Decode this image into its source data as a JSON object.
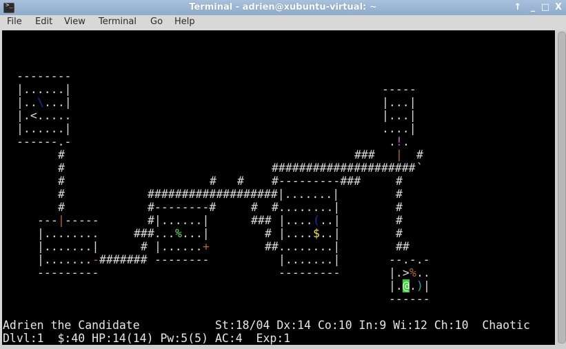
{
  "window": {
    "title": "Terminal - adrien@xubuntu-virtual: ~",
    "icon": "terminal-icon",
    "controls": [
      {
        "name": "keep-above-button",
        "glyph": "↑"
      },
      {
        "name": "minimize-button",
        "glyph": "_"
      },
      {
        "name": "maximize-button",
        "glyph": "□"
      },
      {
        "name": "close-button",
        "glyph": "X"
      }
    ]
  },
  "menu": [
    "File",
    "Edit",
    "View",
    "Terminal",
    "Go",
    "Help"
  ],
  "colors": {
    "default": "#d9d9d9",
    "orange": "#b5673a",
    "green": "#5ee05e",
    "yellow": "#f2e04a",
    "magenta": "#c65bd0",
    "blue": "#1a2fa0",
    "cyan": "#2ea0b0",
    "player_bg": "#34d034"
  },
  "map": [
    {
      "row": 3,
      "runs": [
        [
          2,
          "--------",
          "default"
        ]
      ]
    },
    {
      "row": 4,
      "runs": [
        [
          2,
          "|......|",
          "default"
        ],
        [
          55,
          "-----",
          "default"
        ]
      ]
    },
    {
      "row": 5,
      "runs": [
        [
          2,
          "|..",
          "default"
        ],
        [
          5,
          "\\",
          "blue"
        ],
        [
          6,
          "...|",
          "default"
        ],
        [
          55,
          "|...|",
          "default"
        ]
      ]
    },
    {
      "row": 6,
      "runs": [
        [
          2,
          "|.<.....",
          "default"
        ],
        [
          55,
          "|...|",
          "default"
        ]
      ]
    },
    {
      "row": 7,
      "runs": [
        [
          2,
          "|......|",
          "default"
        ],
        [
          55,
          "....|",
          "default"
        ]
      ]
    },
    {
      "row": 8,
      "runs": [
        [
          2,
          "------.-",
          "default"
        ],
        [
          56,
          ".",
          "default"
        ],
        [
          57,
          "!",
          "magenta"
        ],
        [
          58,
          ".",
          "default"
        ]
      ]
    },
    {
      "row": 9,
      "runs": [
        [
          8,
          "#",
          "default"
        ],
        [
          51,
          "###",
          "default"
        ],
        [
          57,
          "|",
          "orange"
        ],
        [
          60,
          "#",
          "default"
        ]
      ]
    },
    {
      "row": 10,
      "runs": [
        [
          8,
          "#",
          "default"
        ],
        [
          39,
          "#####################",
          "default"
        ],
        [
          60,
          "`",
          "default"
        ]
      ]
    },
    {
      "row": 11,
      "runs": [
        [
          8,
          "#",
          "default"
        ],
        [
          30,
          "#",
          "default"
        ],
        [
          34,
          "#",
          "default"
        ],
        [
          39,
          "#---------###",
          "default"
        ],
        [
          57,
          "#",
          "default"
        ]
      ]
    },
    {
      "row": 12,
      "runs": [
        [
          8,
          "#",
          "default"
        ],
        [
          21,
          "###################|.......|",
          "default"
        ],
        [
          57,
          "#",
          "default"
        ]
      ]
    },
    {
      "row": 13,
      "runs": [
        [
          8,
          "#",
          "default"
        ],
        [
          21,
          "#--------#",
          "default"
        ],
        [
          36,
          "#",
          "default"
        ],
        [
          39,
          "#........|",
          "default"
        ],
        [
          57,
          "#",
          "default"
        ]
      ]
    },
    {
      "row": 14,
      "runs": [
        [
          5,
          "---",
          "default"
        ],
        [
          8,
          "|",
          "orange"
        ],
        [
          9,
          "-----",
          "default"
        ],
        [
          21,
          "#|......|",
          "default"
        ],
        [
          36,
          "###",
          "default"
        ],
        [
          40,
          "|....",
          "default"
        ],
        [
          45,
          "(",
          "blue"
        ],
        [
          46,
          "..|",
          "default"
        ],
        [
          57,
          "#",
          "default"
        ]
      ]
    },
    {
      "row": 15,
      "runs": [
        [
          5,
          "|........",
          "default"
        ],
        [
          19,
          "###...",
          "default"
        ],
        [
          25,
          "%",
          "green"
        ],
        [
          26,
          "...|",
          "default"
        ],
        [
          38,
          "#",
          "default"
        ],
        [
          40,
          "|....",
          "default"
        ],
        [
          45,
          "$",
          "yellow"
        ],
        [
          46,
          "..|",
          "default"
        ],
        [
          57,
          "#",
          "default"
        ]
      ]
    },
    {
      "row": 16,
      "runs": [
        [
          5,
          "|.......|",
          "default"
        ],
        [
          20,
          "#",
          "default"
        ],
        [
          22,
          "|......",
          "default"
        ],
        [
          29,
          "+",
          "orange"
        ],
        [
          38,
          "##........|",
          "default"
        ],
        [
          57,
          "##",
          "default"
        ]
      ]
    },
    {
      "row": 17,
      "runs": [
        [
          5,
          "|.......",
          "default"
        ],
        [
          13,
          "-",
          "orange"
        ],
        [
          14,
          "#######",
          "default"
        ],
        [
          22,
          "--------",
          "default"
        ],
        [
          40,
          "|.......|",
          "default"
        ],
        [
          56,
          "--.-.-",
          "default"
        ]
      ]
    },
    {
      "row": 18,
      "runs": [
        [
          5,
          "---------",
          "default"
        ],
        [
          40,
          "---------",
          "default"
        ],
        [
          56,
          "|.>",
          "default"
        ],
        [
          59,
          "%",
          "orange"
        ],
        [
          60,
          "..",
          "default"
        ]
      ]
    },
    {
      "row": 19,
      "runs": [
        [
          56,
          "|.",
          "default"
        ],
        [
          58,
          "@",
          "player"
        ],
        [
          59,
          ".",
          "default"
        ],
        [
          60,
          ")",
          "cyan"
        ],
        [
          61,
          "|",
          "default"
        ]
      ]
    },
    {
      "row": 20,
      "runs": [
        [
          56,
          "------",
          "default"
        ]
      ]
    }
  ],
  "status": {
    "line1": "Adrien the Candidate           St:18/04 Dx:14 Co:10 In:9 Wi:12 Ch:10  Chaotic",
    "line2": "Dlvl:1  $:40 HP:14(14) Pw:5(5) AC:4  Exp:1"
  }
}
